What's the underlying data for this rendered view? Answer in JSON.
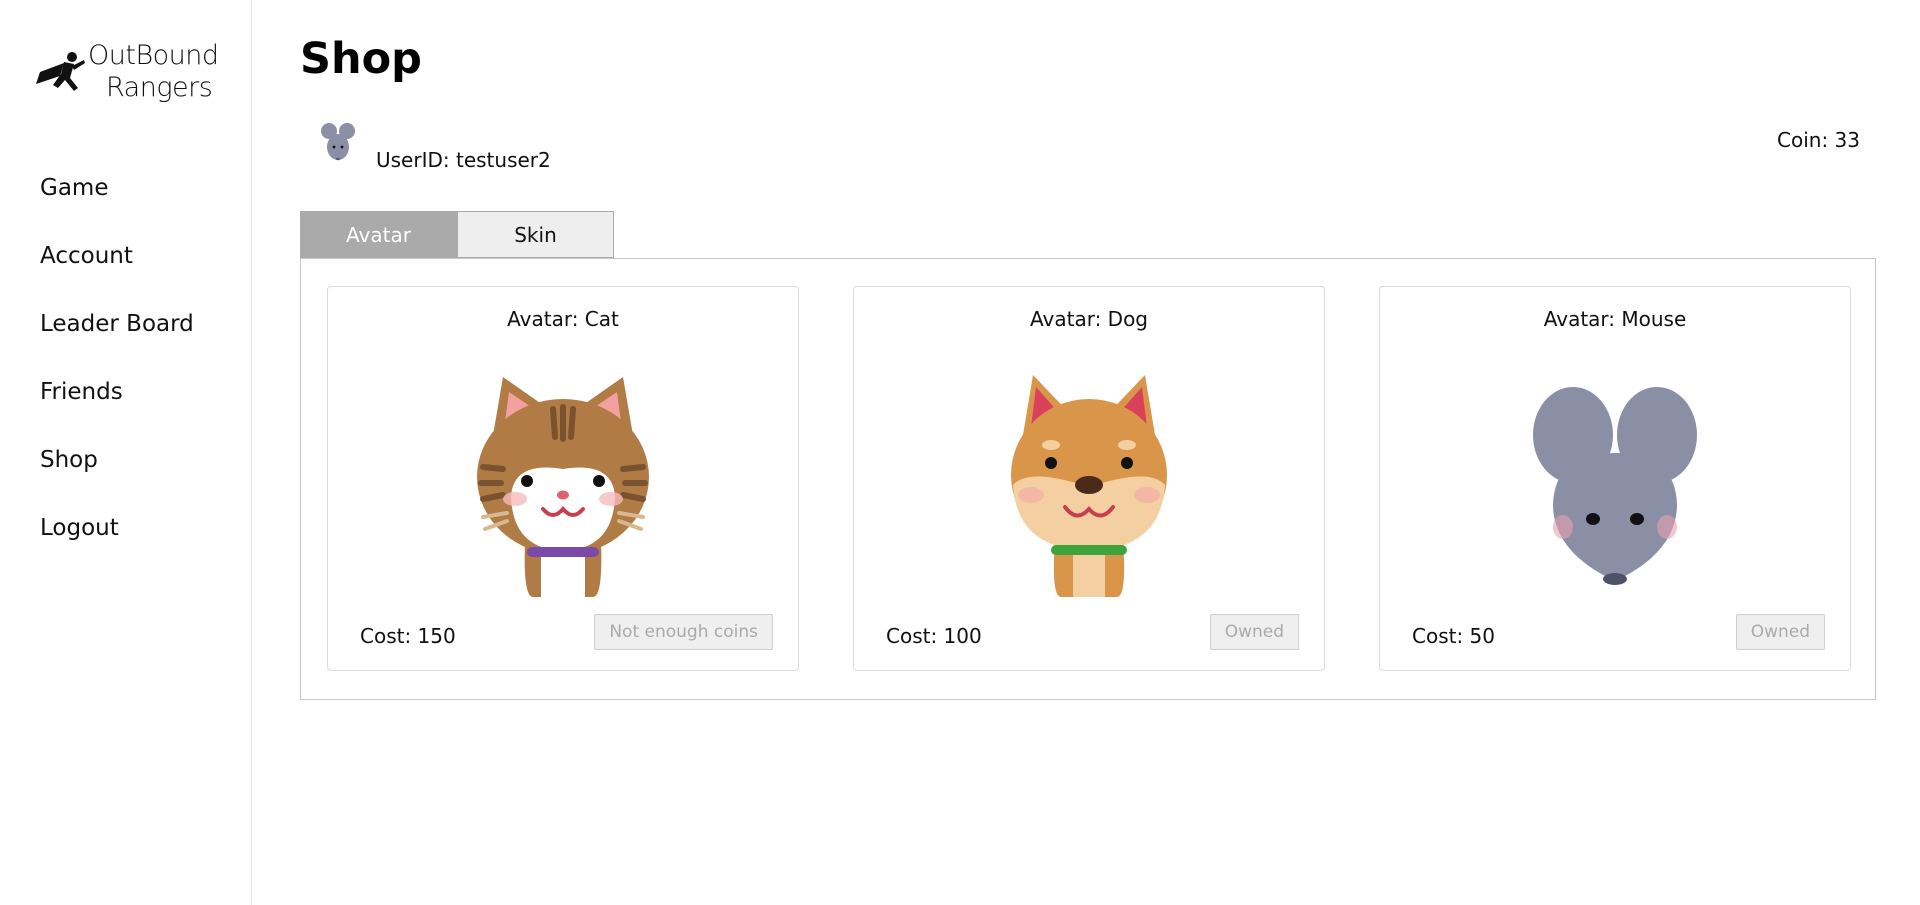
{
  "app": {
    "logo_line1": "OutBound",
    "logo_line2": "Rangers"
  },
  "sidebar": {
    "items": [
      {
        "label": "Game"
      },
      {
        "label": "Account"
      },
      {
        "label": "Leader Board"
      },
      {
        "label": "Friends"
      },
      {
        "label": "Shop"
      },
      {
        "label": "Logout"
      }
    ]
  },
  "page": {
    "title": "Shop",
    "user_id_text": "UserID: testuser2",
    "coin_text": "Coin: 33",
    "user_avatar_icon": "mouse-avatar-icon"
  },
  "tabs": [
    {
      "label": "Avatar",
      "active": true
    },
    {
      "label": "Skin",
      "active": false
    }
  ],
  "products": [
    {
      "title": "Avatar: Cat",
      "cost": "Cost: 150",
      "button": "Not enough coins",
      "icon": "cat-avatar-icon"
    },
    {
      "title": "Avatar: Dog",
      "cost": "Cost: 100",
      "button": "Owned",
      "icon": "dog-avatar-icon"
    },
    {
      "title": "Avatar: Mouse",
      "cost": "Cost: 50",
      "button": "Owned",
      "icon": "mouse-avatar-icon"
    }
  ],
  "colors": {
    "tab_active_bg": "#aaaaaa",
    "tab_inactive_bg": "#eeeeee",
    "disabled_button_text": "#aaaaaa"
  }
}
